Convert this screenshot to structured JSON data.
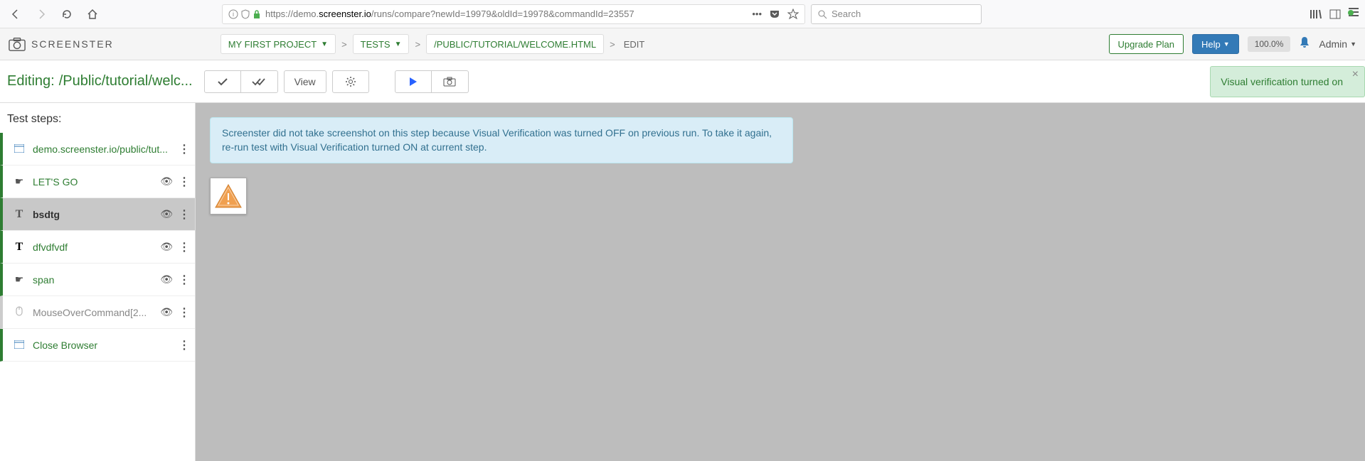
{
  "browser": {
    "url_prefix": "https://demo.",
    "url_domain": "screenster.io",
    "url_suffix": "/runs/compare?newId=19979&oldId=19978&commandId=23557",
    "search_placeholder": "Search"
  },
  "app": {
    "logo": "SCREENSTER",
    "breadcrumb": {
      "project": "MY FIRST PROJECT",
      "tests": "TESTS",
      "path": "/PUBLIC/TUTORIAL/WELCOME.HTML",
      "current": "EDIT"
    },
    "upgrade": "Upgrade Plan",
    "help": "Help",
    "zoom": "100.0%",
    "admin": "Admin"
  },
  "toolbar": {
    "editing": "Editing:",
    "path": "/Public/tutorial/welc...",
    "view": "View",
    "notification": "Visual verification turned on"
  },
  "sidebar": {
    "title": "Test steps:",
    "steps": [
      {
        "label": "demo.screenster.io/public/tut..."
      },
      {
        "label": "LET'S GO"
      },
      {
        "label": "bsdtg"
      },
      {
        "label": "dfvdfvdf"
      },
      {
        "label": "span"
      },
      {
        "label": "MouseOverCommand[2..."
      },
      {
        "label": "Close Browser"
      }
    ]
  },
  "content": {
    "banner": "Screenster did not take screenshot on this step because Visual Verification was turned OFF on previous run. To take it again, re-run test with Visual Verification turned ON at current step."
  }
}
